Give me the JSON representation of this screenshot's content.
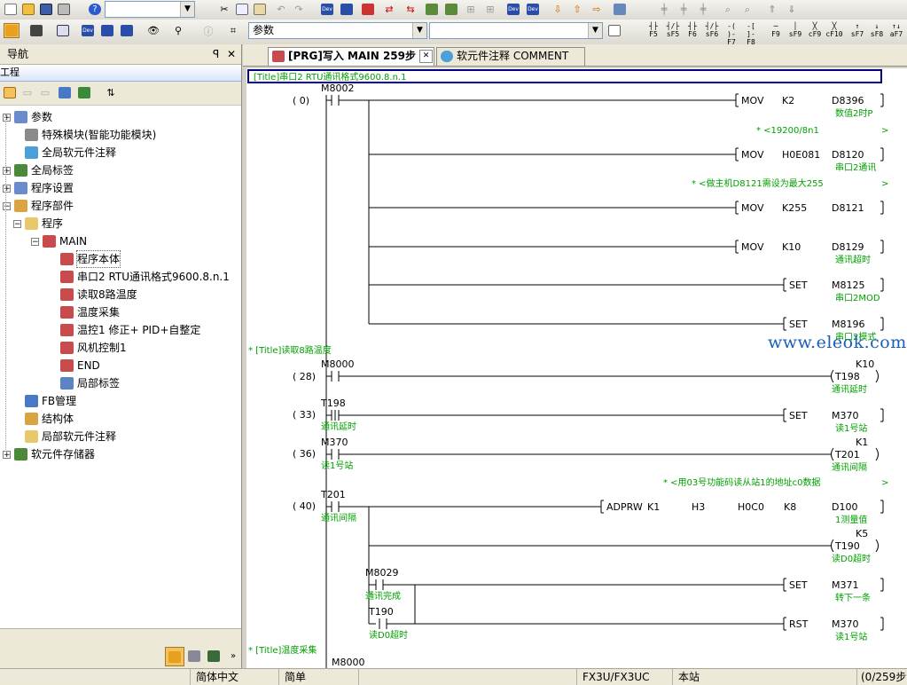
{
  "toolbar": {
    "row1_combo_value": "",
    "help_icon_label": "?",
    "device_icons": [
      "Dev",
      "Dev",
      "Dev",
      "Dev"
    ]
  },
  "toolbar2": {
    "param_combo_value": "参数",
    "second_combo_value": "",
    "fkeys": [
      {
        "sym": "┤├",
        "label": "F5"
      },
      {
        "sym": "┤/├",
        "label": "sF5"
      },
      {
        "sym": "┤├",
        "label": "F6"
      },
      {
        "sym": "┤/├",
        "label": "sF6"
      },
      {
        "sym": "-( )-",
        "label": "F7"
      },
      {
        "sym": "-[ ]-",
        "label": "F8"
      },
      {
        "sym": "─",
        "label": "F9"
      },
      {
        "sym": "│",
        "label": "sF9"
      },
      {
        "sym": "╳",
        "label": "cF9"
      },
      {
        "sym": "╳",
        "label": "cF10"
      },
      {
        "sym": "↑",
        "label": "sF7"
      },
      {
        "sym": "↓",
        "label": "sF8"
      },
      {
        "sym": "↑↓",
        "label": "aF7"
      }
    ]
  },
  "nav": {
    "title": "导航",
    "pin": "ᵖ",
    "close": "✕",
    "project_header": "工程",
    "items": [
      {
        "label": "参数",
        "level": 0,
        "expander": "+",
        "icon": "#6a8ccc"
      },
      {
        "label": "特殊模块(智能功能模块)",
        "level": 1,
        "expander": "",
        "icon": "#8a8a8a"
      },
      {
        "label": "全局软元件注释",
        "level": 1,
        "expander": "",
        "icon": "#4aa0d8"
      },
      {
        "label": "全局标签",
        "level": 0,
        "expander": "+",
        "icon": "#4b8a3a"
      },
      {
        "label": "程序设置",
        "level": 0,
        "expander": "+",
        "icon": "#6a8ccc"
      },
      {
        "label": "程序部件",
        "level": 0,
        "expander": "−",
        "icon": "#d9a441"
      },
      {
        "label": "程序",
        "level": 1,
        "expander": "−",
        "icon": "#e8c86a"
      },
      {
        "label": "MAIN",
        "level": 2,
        "expander": "−",
        "icon": "#c94b4b"
      },
      {
        "label": "程序本体",
        "level": 3,
        "expander": "",
        "icon": "#c94b4b",
        "selected": true
      },
      {
        "label": "串口2  RTU通讯格式9600.8.n.1",
        "level": 3,
        "expander": "",
        "icon": "#c94b4b"
      },
      {
        "label": "读取8路温度",
        "level": 3,
        "expander": "",
        "icon": "#c94b4b"
      },
      {
        "label": "温度采集",
        "level": 3,
        "expander": "",
        "icon": "#c94b4b"
      },
      {
        "label": "温控1  修正+ PID+自整定",
        "level": 3,
        "expander": "",
        "icon": "#c94b4b"
      },
      {
        "label": "风机控制1",
        "level": 3,
        "expander": "",
        "icon": "#c94b4b"
      },
      {
        "label": "END",
        "level": 3,
        "expander": "",
        "icon": "#c94b4b"
      },
      {
        "label": "局部标签",
        "level": 3,
        "expander": "",
        "icon": "#5b84c6"
      },
      {
        "label": "FB管理",
        "level": 1,
        "expander": "",
        "icon": "#4a78c8"
      },
      {
        "label": "结构体",
        "level": 1,
        "expander": "",
        "icon": "#d9a441"
      },
      {
        "label": "局部软元件注释",
        "level": 1,
        "expander": "",
        "icon": "#e8c86a"
      },
      {
        "label": "软元件存储器",
        "level": 0,
        "expander": "+",
        "icon": "#4b8a3a"
      }
    ]
  },
  "tabs": [
    {
      "label": "[PRG]写入 MAIN 259步",
      "active": true
    },
    {
      "label": "软元件注释 COMMENT",
      "active": false
    }
  ],
  "ladder": {
    "titles": [
      "[Title]串口2  RTU通讯格式9600.8.n.1",
      "* [Title]读取8路温度",
      "* [Title]温度采集"
    ],
    "step_numbers": [
      "(     0)",
      "(    28)",
      "(    33)",
      "(    36)",
      "(    40)"
    ],
    "contacts": [
      {
        "device": "M8002",
        "comment": ""
      },
      {
        "device": "M8000",
        "comment": ""
      },
      {
        "device": "T198",
        "comment": "通讯延时"
      },
      {
        "device": "M370",
        "comment": "读1号站"
      },
      {
        "device": "T201",
        "comment": "通讯间隔"
      },
      {
        "device": "M8029",
        "comment": "通讯完成"
      },
      {
        "device": "T190",
        "comment": "读D0超时"
      }
    ],
    "instructions": [
      {
        "op": "MOV",
        "a": "K2",
        "b": "D8396",
        "comment": "数值2时P"
      },
      {
        "op": "MOV",
        "a": "H0E081",
        "b": "D8120",
        "comment": "串口2通讯"
      },
      {
        "op": "MOV",
        "a": "K255",
        "b": "D8121",
        "comment": ""
      },
      {
        "op": "MOV",
        "a": "K10",
        "b": "D8129",
        "comment": "通讯超时"
      },
      {
        "op": "SET",
        "a": "",
        "b": "M8125",
        "comment": "串口2MOD"
      },
      {
        "op": "SET",
        "a": "",
        "b": "M8196",
        "comment": "串口2模式"
      },
      {
        "op": "SET",
        "a": "",
        "b": "M370",
        "comment": "读1号站"
      },
      {
        "op": "ADPRW",
        "a": "K1",
        "b": "D100",
        "comment": "1测量值",
        "extra": [
          "H3",
          "H0C0",
          "K8"
        ]
      },
      {
        "op": "SET",
        "a": "",
        "b": "M371",
        "comment": "转下一条"
      },
      {
        "op": "RST",
        "a": "",
        "b": "M370",
        "comment": "读1号站"
      }
    ],
    "coils": [
      {
        "device": "T198",
        "k": "K10",
        "comment": "通讯延时"
      },
      {
        "device": "T201",
        "k": "K1",
        "comment": "通讯间隔"
      },
      {
        "device": "T190",
        "k": "K5",
        "comment": "读D0超时"
      }
    ],
    "notes": [
      "* <19200/8n1",
      "* <做主机D8121需设为最大255",
      "* <用03号功能码读从站1的地址c0数据"
    ],
    "partial_next": "M8000"
  },
  "watermark": "www.eleok.com",
  "status": {
    "language": "简体中文",
    "mode": "简单",
    "cpu": "FX3U/FX3UC",
    "station": "本站",
    "steps": "(0/259步)"
  },
  "colors": {
    "comment": "#00a000",
    "title_border": "#000080",
    "watermark": "#1a5fb4"
  }
}
